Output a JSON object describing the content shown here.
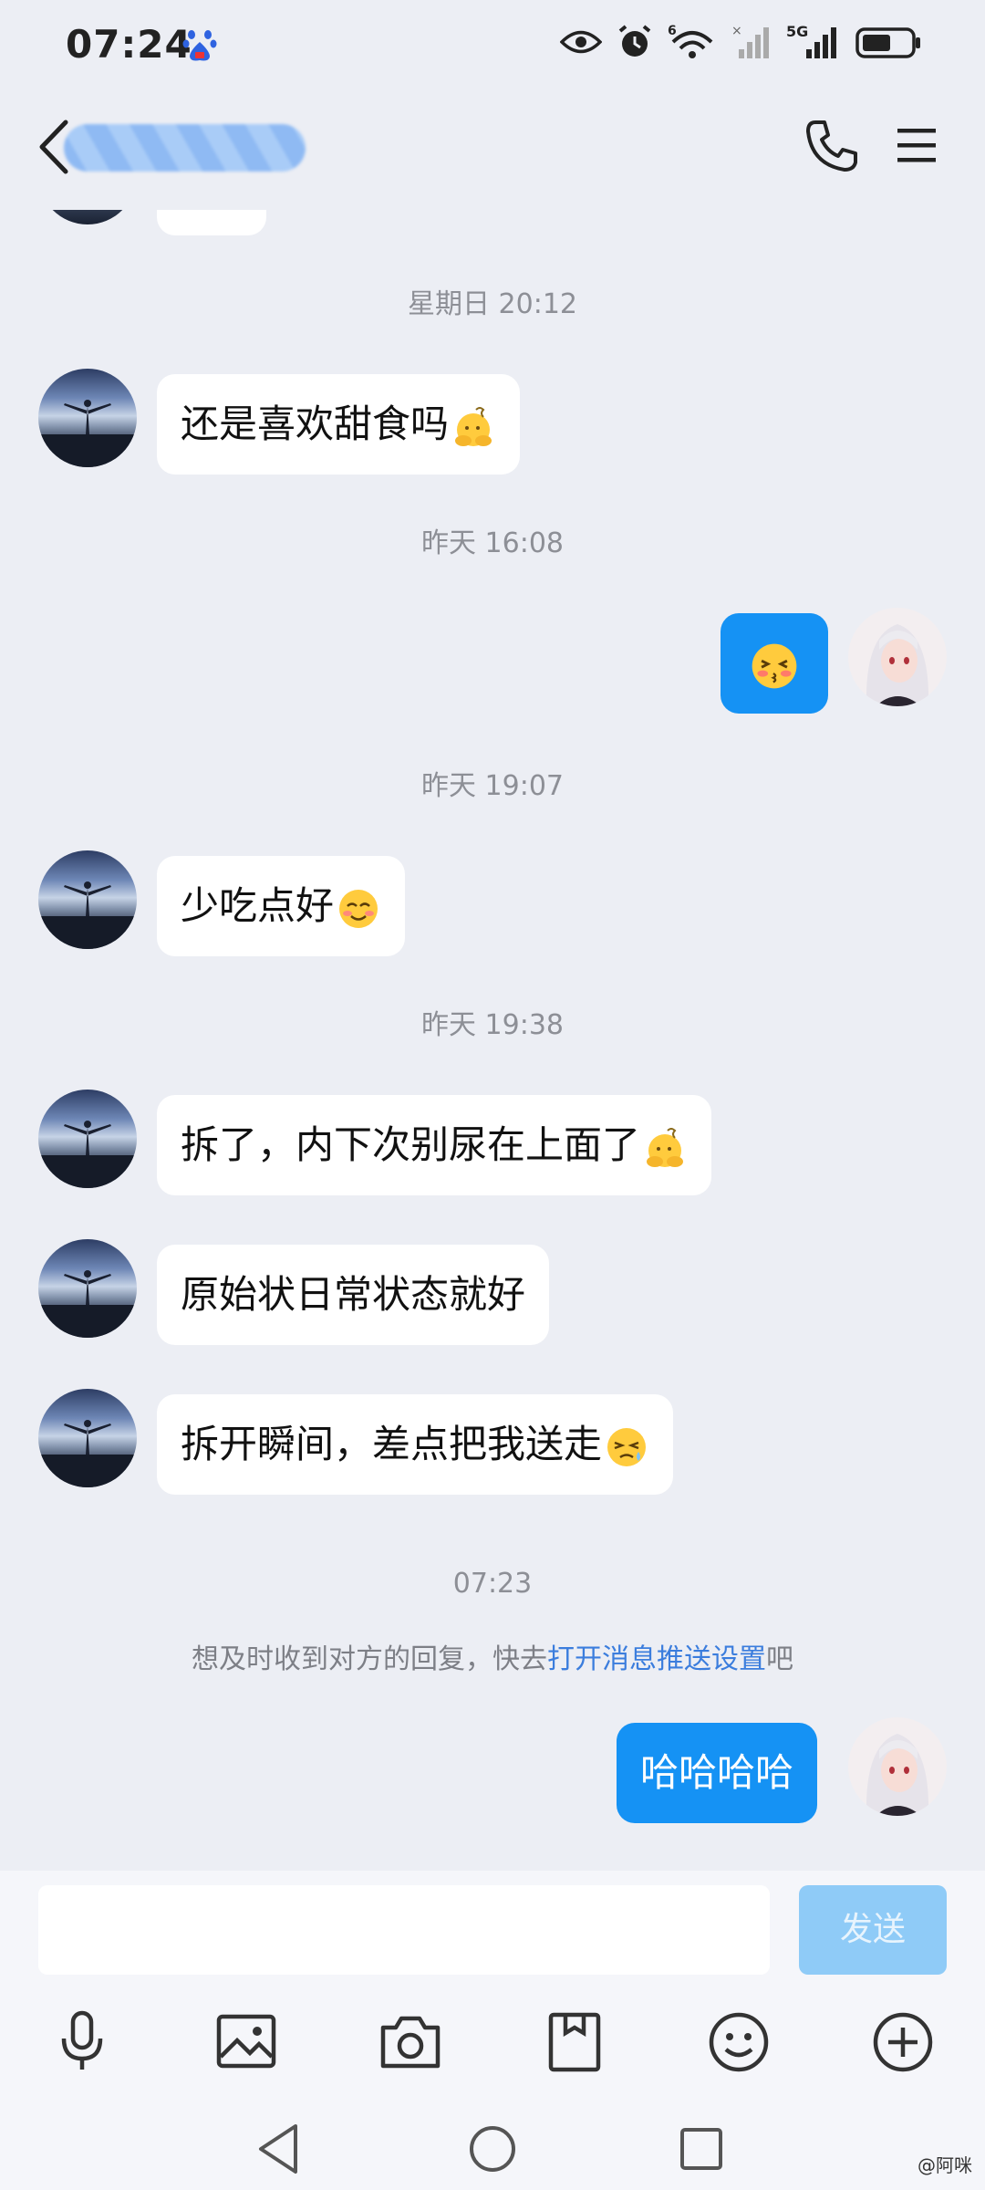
{
  "status_bar": {
    "time": "07:24",
    "network": "5G",
    "wifi_badge": "6",
    "icons": [
      "baidu-icon",
      "eye-icon",
      "alarm-icon",
      "wifi-icon",
      "cellular-icon",
      "battery-icon"
    ]
  },
  "header": {
    "contact_name_hidden": true,
    "icons": [
      "back-icon",
      "phone-icon",
      "menu-icon"
    ]
  },
  "messages": [
    {
      "type": "timestamp",
      "text": "星期日 20:12"
    },
    {
      "type": "incoming",
      "text": "还是喜欢甜食吗",
      "emoji": "thinking-hands-emoji"
    },
    {
      "type": "timestamp",
      "text": "昨天 16:08"
    },
    {
      "type": "outgoing",
      "text": "",
      "emoji": "kiss-emoji"
    },
    {
      "type": "timestamp",
      "text": "昨天 19:07"
    },
    {
      "type": "incoming",
      "text": "少吃点好",
      "emoji": "smile-emoji"
    },
    {
      "type": "timestamp",
      "text": "昨天 19:38"
    },
    {
      "type": "incoming",
      "text": "拆了，内下次别尿在上面了",
      "emoji": "thinking-hands-emoji"
    },
    {
      "type": "incoming",
      "text": "原始状日常状态就好",
      "emoji": ""
    },
    {
      "type": "incoming",
      "text": "拆开瞬间，差点把我送走",
      "emoji": "speechless-emoji"
    },
    {
      "type": "timestamp",
      "text": "07:23"
    },
    {
      "type": "outgoing",
      "text": "哈哈哈哈",
      "emoji": ""
    }
  ],
  "notice": {
    "prefix": "想及时收到对方的回复，快去",
    "link": "打开消息推送设置",
    "suffix": "吧"
  },
  "composer": {
    "input_value": "",
    "send_label": "发送",
    "tools": [
      "microphone-icon",
      "image-icon",
      "camera-icon",
      "file-icon",
      "emoji-icon",
      "plus-icon"
    ]
  },
  "navigation": [
    "nav-back-icon",
    "nav-home-icon",
    "nav-recents-icon"
  ],
  "watermark": "@阿咪",
  "colors": {
    "background": "#eceef4",
    "outgoing_bubble": "#1592f4",
    "incoming_bubble": "#ffffff",
    "link": "#3b7ddd",
    "send_button_disabled": "#8fcbf7"
  }
}
